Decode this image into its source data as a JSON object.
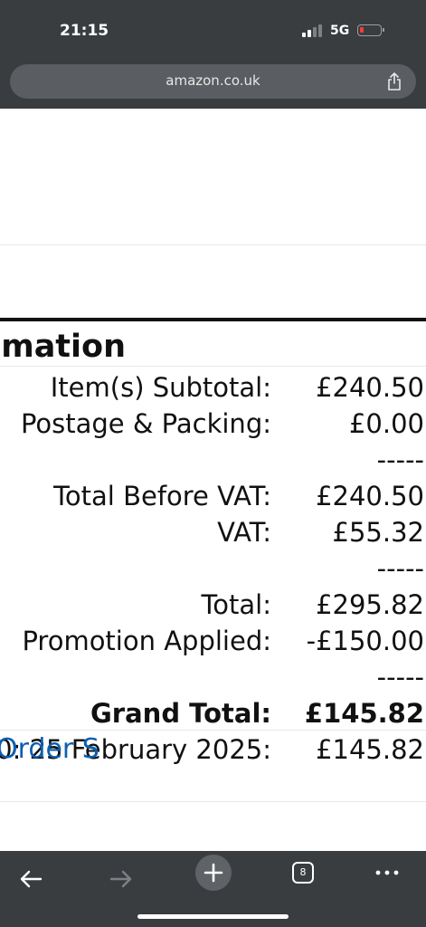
{
  "status_bar": {
    "time": "21:15",
    "network": "5G",
    "battery_color": "#ff3b30"
  },
  "browser": {
    "url": "amazon.co.uk",
    "tab_count": "8",
    "icons": [
      "share-icon",
      "back-arrow-icon",
      "forward-arrow-icon",
      "plus-icon",
      "tabs-icon",
      "more-icon"
    ]
  },
  "order_summary": {
    "heading_fragment": "mation",
    "rows": [
      {
        "label": "Item(s) Subtotal:",
        "value": "£240.50"
      },
      {
        "label": "Postage & Packing:",
        "value": "£0.00"
      },
      {
        "label": "",
        "value": "-----"
      },
      {
        "label": "Total Before VAT:",
        "value": "£240.50"
      },
      {
        "label": "VAT:",
        "value": "£55.32"
      },
      {
        "label": "",
        "value": "-----"
      },
      {
        "label": "Total:",
        "value": "£295.82"
      },
      {
        "label": "Promotion Applied:",
        "value": "-£150.00"
      },
      {
        "label": "",
        "value": "-----"
      },
      {
        "label": "Grand Total:",
        "value": "£145.82"
      },
      {
        "label": "0: 25 February 2025:",
        "value": "£145.82"
      }
    ],
    "link_fragment": "Order S"
  }
}
